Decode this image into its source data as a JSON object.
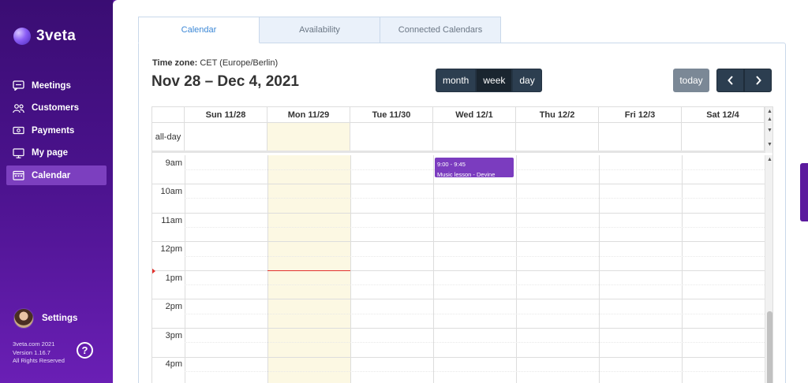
{
  "brand": {
    "name": "3veta"
  },
  "sidebar": {
    "items": [
      {
        "label": "Meetings",
        "icon": "chat-icon"
      },
      {
        "label": "Customers",
        "icon": "users-icon"
      },
      {
        "label": "Payments",
        "icon": "cash-icon"
      },
      {
        "label": "My page",
        "icon": "monitor-icon"
      },
      {
        "label": "Calendar",
        "icon": "calendar-icon",
        "active": true
      }
    ],
    "settings_label": "Settings",
    "footer": {
      "line1": "3veta.com 2021",
      "line2": "Version 1.16.7",
      "line3": "All Rights Reserved"
    },
    "help_label": "?"
  },
  "tabs": [
    {
      "label": "Calendar",
      "active": true
    },
    {
      "label": "Availability"
    },
    {
      "label": "Connected Calendars"
    }
  ],
  "calendar": {
    "timezone_label": "Time zone:",
    "timezone_value": "CET (Europe/Berlin)",
    "range_title": "Nov 28 – Dec 4, 2021",
    "view_buttons": [
      "month",
      "week",
      "day"
    ],
    "active_view": "week",
    "today_label": "today",
    "prev_label": "‹",
    "next_label": "›",
    "allday_label": "all-day",
    "days": [
      "Sun 11/28",
      "Mon 11/29",
      "Tue 11/30",
      "Wed 12/1",
      "Thu 12/2",
      "Fri 12/3",
      "Sat 12/4"
    ],
    "hours": [
      "9am",
      "10am",
      "11am",
      "12pm",
      "1pm",
      "2pm",
      "3pm",
      "4pm"
    ],
    "event": {
      "time": "9:00 - 9:45",
      "title": "Music lesson - Devine",
      "color": "#7b3cbf"
    }
  }
}
